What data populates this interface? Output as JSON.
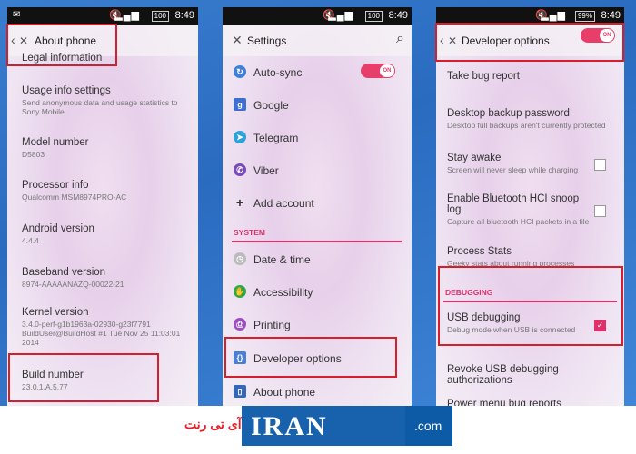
{
  "status": {
    "time": "8:49",
    "battery_p1": "100",
    "battery_p2": "100",
    "battery_p3": "99%"
  },
  "about": {
    "title": "About phone",
    "clipped": "Legal information",
    "items": [
      {
        "title": "Usage info settings",
        "sub": "Send anonymous data and usage statistics to Sony Mobile"
      },
      {
        "title": "Model number",
        "sub": "D5803"
      },
      {
        "title": "Processor info",
        "sub": "Qualcomm MSM8974PRO-AC"
      },
      {
        "title": "Android version",
        "sub": "4.4.4"
      },
      {
        "title": "Baseband version",
        "sub": "8974-AAAAANAZQ-00022-21"
      },
      {
        "title": "Kernel version",
        "sub": "3.4.0-perf-g1b1963a-02930-g23f7791 BuildUser@BuildHost #1 Tue Nov 25 11:03:01 2014"
      },
      {
        "title": "Build number",
        "sub": "23.0.1.A.5.77"
      }
    ]
  },
  "settings": {
    "title": "Settings",
    "toggle": "ON",
    "items_top": [
      {
        "label": "Auto-sync",
        "icon": "sync-icon",
        "color": "#3f7fd8"
      },
      {
        "label": "Google",
        "icon": "google-icon",
        "color": "#3c6fd0"
      },
      {
        "label": "Telegram",
        "icon": "telegram-icon",
        "color": "#2aa3dc"
      },
      {
        "label": "Viber",
        "icon": "viber-icon",
        "color": "#7a4bb8"
      },
      {
        "label": "Add account",
        "icon": "plus-icon",
        "color": "#444444"
      }
    ],
    "section": "SYSTEM",
    "items_bottom": [
      {
        "label": "Date & time",
        "icon": "clock-icon",
        "color": "#999999"
      },
      {
        "label": "Accessibility",
        "icon": "accessibility-icon",
        "color": "#2ea84a"
      },
      {
        "label": "Printing",
        "icon": "printer-icon",
        "color": "#9b4fc0"
      },
      {
        "label": "Developer options",
        "icon": "developer-icon",
        "color": "#4a7fd6"
      },
      {
        "label": "About phone",
        "icon": "phone-icon",
        "color": "#3766b8"
      }
    ]
  },
  "developer": {
    "title": "Developer options",
    "toggle": "ON",
    "items": [
      {
        "title": "Take bug report",
        "sub": ""
      },
      {
        "title": "Desktop backup password",
        "sub": "Desktop full backups aren't currently protected"
      },
      {
        "title": "Stay awake",
        "sub": "Screen will never sleep while charging"
      },
      {
        "title": "Enable Bluetooth HCI snoop log",
        "sub": "Capture all bluetooth HCI packets in a file"
      },
      {
        "title": "Process Stats",
        "sub": "Geeky stats about running processes"
      }
    ],
    "section": "DEBUGGING",
    "usb": {
      "title": "USB debugging",
      "sub": "Debug mode when USB is connected"
    },
    "revoke": "Revoke USB debugging authorizations",
    "power": "Power menu bug reports"
  },
  "footer": {
    "fa": "آی تی رنت",
    "brand": "IRAN",
    "com": ".com"
  }
}
